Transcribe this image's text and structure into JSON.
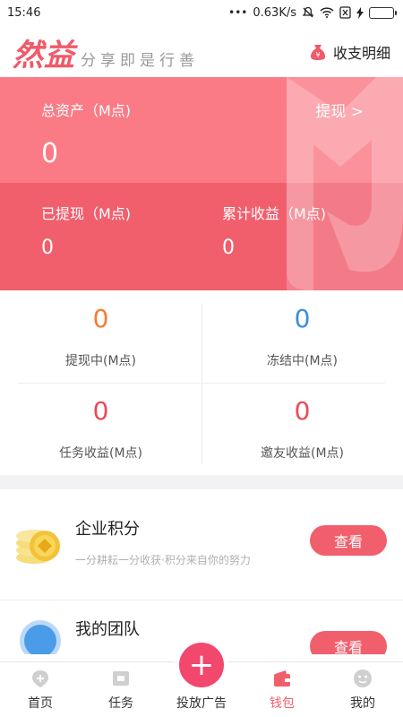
{
  "status_bar": {
    "time": "15:46",
    "net_speed": "0.63K/s"
  },
  "header": {
    "logo": "然益",
    "slogan": "分享即是行善",
    "detail_label": "收支明细"
  },
  "assets": {
    "total_label": "总资产（M点)",
    "total_value": "0",
    "withdraw_label": "提现 >",
    "withdrawn_label": "已提现（M点)",
    "withdrawn_value": "0",
    "cumulative_label": "累计收益（M点)",
    "cumulative_value": "0"
  },
  "stats": [
    {
      "value": "0",
      "label": "提现中(M点)",
      "color": "#f47d2f"
    },
    {
      "value": "0",
      "label": "冻结中(M点)",
      "color": "#3c8fd8"
    },
    {
      "value": "0",
      "label": "任务收益(M点)",
      "color": "#ea4b55"
    },
    {
      "value": "0",
      "label": "邀友收益(M点)",
      "color": "#ea4b55"
    }
  ],
  "features": [
    {
      "title": "企业积分",
      "desc": "一分耕耘一分收获·积分来自你的努力",
      "button": "查看"
    },
    {
      "title": "我的团队",
      "button": "查看"
    }
  ],
  "tabbar": {
    "items": [
      "首页",
      "任务",
      "投放广告",
      "钱包",
      "我的"
    ],
    "active_index": 3,
    "fab_symbol": "+"
  },
  "colors": {
    "accent": "#f15f6d",
    "card_light": "#fa7b85",
    "fab": "#f2486e"
  }
}
